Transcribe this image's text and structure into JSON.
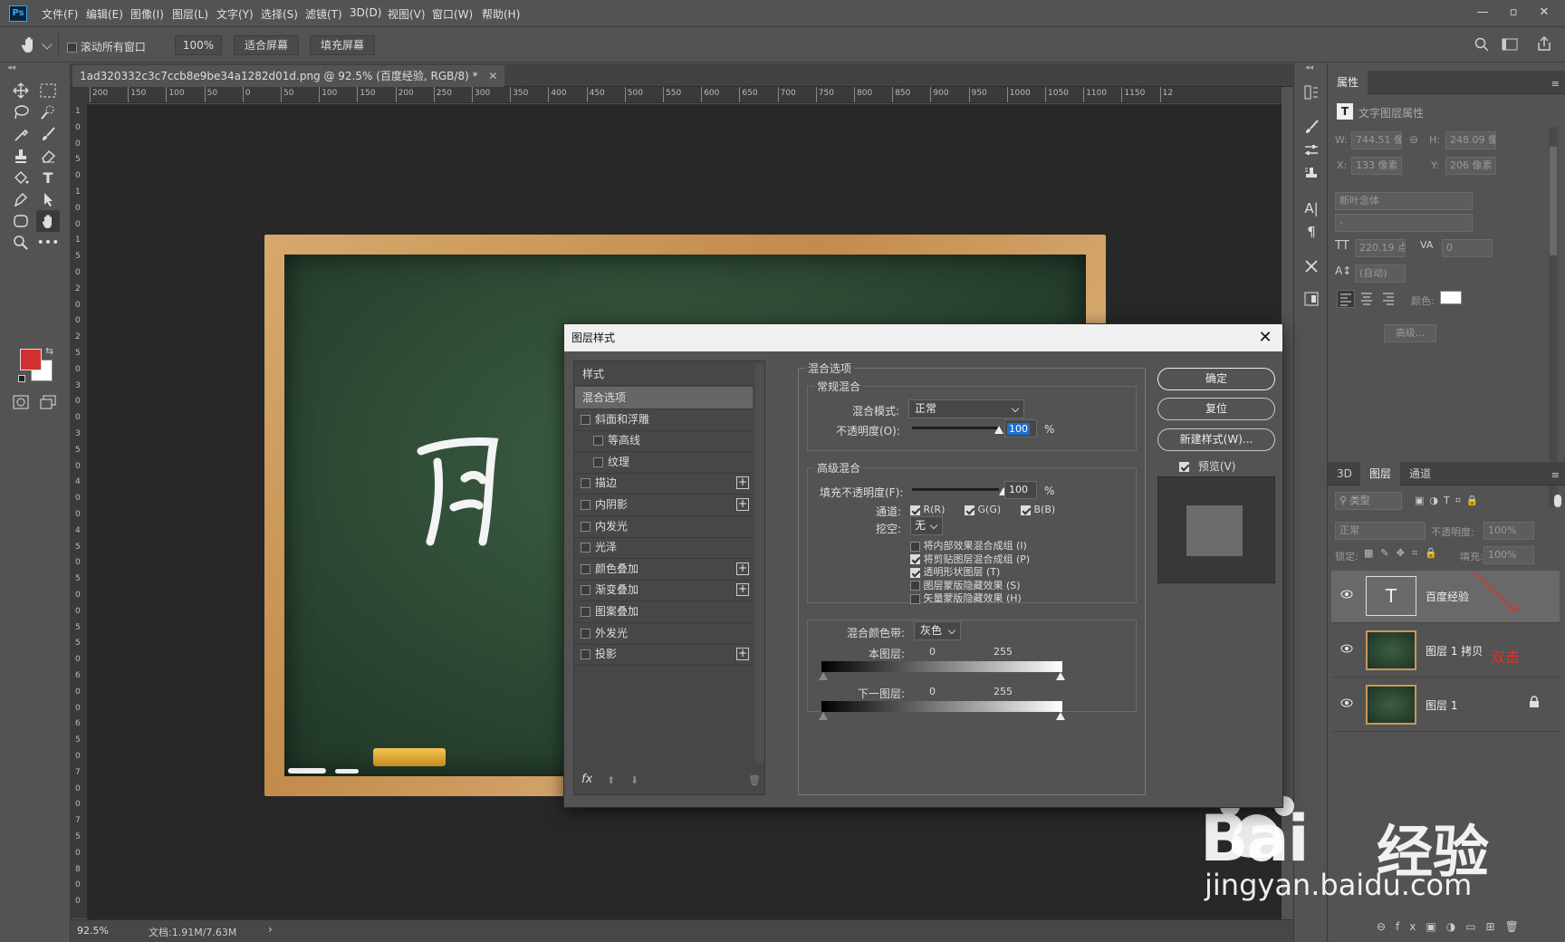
{
  "app": {
    "logo": "Ps",
    "menus": [
      "文件(F)",
      "编辑(E)",
      "图像(I)",
      "图层(L)",
      "文字(Y)",
      "选择(S)",
      "滤镜(T)",
      "3D(D)",
      "视图(V)",
      "窗口(W)",
      "帮助(H)"
    ]
  },
  "options": {
    "scroll_all_label": "滚动所有窗口",
    "zoom_value": "100%",
    "fit_screen": "适合屏幕",
    "fill_screen": "填充屏幕"
  },
  "document": {
    "tab_title": "1ad320332c3c7ccb8e9be34a1282d01d.png @ 92.5% (百度经验, RGB/8) *",
    "ruler_h": [
      "200",
      "150",
      "100",
      "50",
      "0",
      "50",
      "100",
      "150",
      "200",
      "250",
      "300",
      "350",
      "400",
      "450",
      "500",
      "550",
      "600",
      "650",
      "700",
      "750",
      "800",
      "850",
      "900",
      "950",
      "1000",
      "1050",
      "1100",
      "1150",
      "12"
    ],
    "ruler_v": [
      "1",
      "0",
      "0",
      "5",
      "0",
      "1",
      "0",
      "0",
      "1",
      "5",
      "0",
      "2",
      "0",
      "0",
      "2",
      "5",
      "0",
      "3",
      "0",
      "0",
      "3",
      "5",
      "0",
      "4",
      "0",
      "0",
      "4",
      "5",
      "0",
      "5",
      "0",
      "0",
      "5",
      "5",
      "0",
      "6",
      "0",
      "0",
      "6",
      "5",
      "0",
      "7",
      "0",
      "0",
      "7",
      "5",
      "0",
      "8",
      "0",
      "0"
    ],
    "zoom": "92.5%",
    "doc_size": "文档:1.91M/7.63M"
  },
  "properties": {
    "tab": "属性",
    "subtitle": "文字图层属性",
    "w_label": "W:",
    "w_value": "744.51 像素",
    "h_label": "H:",
    "h_value": "248.09 像素",
    "x_label": "X:",
    "x_value": "133 像素",
    "y_label": "Y:",
    "y_value": "206 像素",
    "font_family": "新叶念体",
    "font_style": "-",
    "font_size": "220.19 点",
    "tracking": "0",
    "leading": "(自动)",
    "color_label": "颜色:",
    "advanced": "高级..."
  },
  "layers_panel": {
    "tabs": [
      "3D",
      "图层",
      "通道"
    ],
    "filter_placeholder": "类型",
    "blend_mode": "正常",
    "opacity_label": "不透明度:",
    "opacity_value": "100%",
    "lock_label": "锁定:",
    "fill_label": "填充:",
    "fill_value": "100%",
    "layers": [
      {
        "name": "百度经验",
        "type": "text",
        "thumb_glyph": "T"
      },
      {
        "name": "图层 1 拷贝",
        "type": "image"
      },
      {
        "name": "图层 1",
        "type": "image",
        "locked": true
      }
    ],
    "annotation": "双击"
  },
  "watermark": {
    "brand": "Bai",
    "brand2": "经验",
    "url": "jingyan.baidu.com"
  },
  "dialog": {
    "title": "图层样式",
    "styles_header": "样式",
    "styles": [
      {
        "label": "混合选项",
        "check": false,
        "plus": false,
        "selected": true
      },
      {
        "label": "斜面和浮雕",
        "check": true,
        "plus": false
      },
      {
        "label": "等高线",
        "check": true,
        "plus": false,
        "indent": true
      },
      {
        "label": "纹理",
        "check": true,
        "plus": false,
        "indent": true
      },
      {
        "label": "描边",
        "check": true,
        "plus": true
      },
      {
        "label": "内阴影",
        "check": true,
        "plus": true
      },
      {
        "label": "内发光",
        "check": true,
        "plus": false
      },
      {
        "label": "光泽",
        "check": true,
        "plus": false
      },
      {
        "label": "颜色叠加",
        "check": true,
        "plus": true
      },
      {
        "label": "渐变叠加",
        "check": true,
        "plus": true
      },
      {
        "label": "图案叠加",
        "check": true,
        "plus": false
      },
      {
        "label": "外发光",
        "check": true,
        "plus": false
      },
      {
        "label": "投影",
        "check": true,
        "plus": true
      }
    ],
    "blend_options": "混合选项",
    "general_blend": "常规混合",
    "blend_mode_label": "混合模式:",
    "blend_mode": "正常",
    "opacity_label": "不透明度(O):",
    "opacity": "100",
    "pct": "%",
    "opacity_level": 1.0,
    "advanced_blend": "高级混合",
    "fill_opacity_label": "填充不透明度(F):",
    "fill_opacity": "100",
    "channels_label": "通道:",
    "ch_r": "R(R)",
    "ch_g": "G(G)",
    "ch_b": "B(B)",
    "knockout_label": "挖空:",
    "knockout": "无",
    "opt1": "将内部效果混合成组 (I)",
    "opt2": "将剪贴图层混合成组 (P)",
    "opt3": "透明形状图层 (T)",
    "opt4": "图层蒙版隐藏效果 (S)",
    "opt5": "矢量蒙版隐藏效果 (H)",
    "blend_if_label": "混合颜色带:",
    "blend_if": "灰色",
    "this_layer": "本图层:",
    "under_layer": "下一图层:",
    "v0": "0",
    "v255": "255",
    "ok": "确定",
    "reset": "复位",
    "new_style": "新建样式(W)...",
    "preview": "预览(V)"
  },
  "colors": {
    "foreground": "#d03030",
    "background": "#ffffff",
    "accent": "#31a8ff",
    "annotation": "#e0302a"
  }
}
